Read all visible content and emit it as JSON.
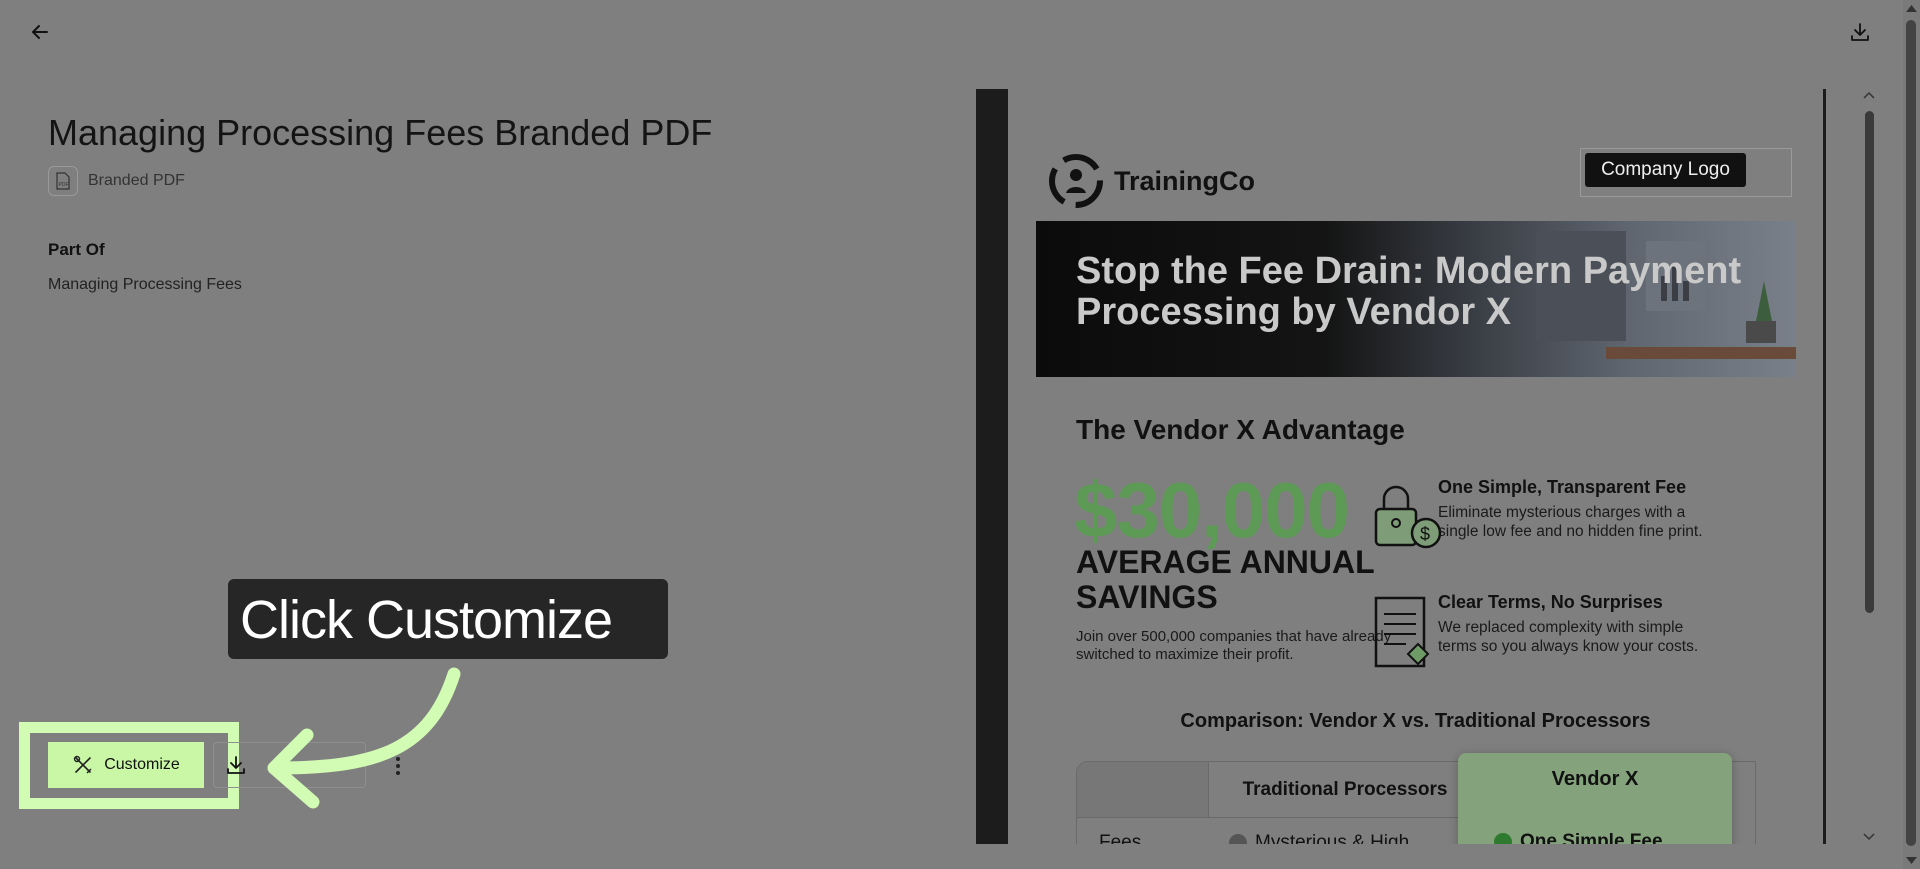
{
  "header": {
    "back_icon": "arrow-left-icon",
    "download_icon": "download-icon"
  },
  "asset": {
    "title": "Managing Processing Fees Branded PDF",
    "type_label": "Branded PDF",
    "type_icon": "pdf-file-icon",
    "part_of_heading": "Part Of",
    "part_of_value": "Managing Processing Fees"
  },
  "tooltip": {
    "text": "Click Customize"
  },
  "actions": {
    "customize_label": "Customize",
    "customize_icon": "paintbrush-ruler-icon",
    "download_icon": "download-icon",
    "more_icon": "more-vertical-icon"
  },
  "preview": {
    "brand_name": "TrainingCo",
    "company_logo": "Company Logo",
    "hero_title": "Stop the Fee Drain: Modern Payment Processing by Vendor X",
    "section_title": "The Vendor X Advantage",
    "big_number": "$30,000",
    "big_label": "AVERAGE ANNUAL SAVINGS",
    "big_sub": "Join over 500,000 companies that have already switched to maximize their profit.",
    "features": [
      {
        "heading": "One Simple, Transparent Fee",
        "text": "Eliminate mysterious charges with a single low fee and no hidden fine print.",
        "icon": "padlock-dollar-icon"
      },
      {
        "heading": "Clear Terms, No Surprises",
        "text": "We replaced complexity with simple terms so you always know your costs.",
        "icon": "document-check-icon"
      }
    ],
    "comparison_title": "Comparison: Vendor X vs. Traditional Processors",
    "table": {
      "col_traditional": "Traditional Processors",
      "col_vendor": "Vendor X",
      "row_label": "Fees",
      "row_traditional": "Mysterious & High",
      "row_vendor": "One Simple Fee"
    }
  },
  "colors": {
    "highlight": "#d2fbb4",
    "customize_bg": "#c9f7a6",
    "savings_green": "#5d9a56"
  }
}
